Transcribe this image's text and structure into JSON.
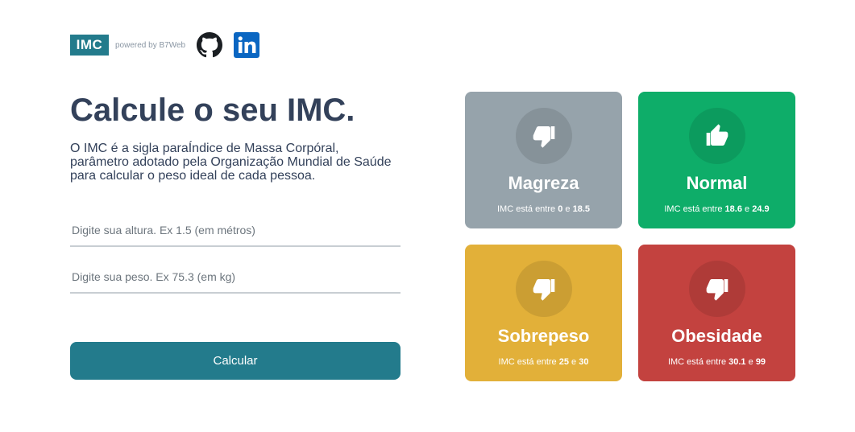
{
  "header": {
    "logo_text": "IMC",
    "powered_text": "powered by B7Web",
    "github_icon": "github-icon",
    "linkedin_icon": "linkedin-icon",
    "linkedin_color": "#0a66c2"
  },
  "main": {
    "title": "Calcule o seu IMC.",
    "description": "O IMC é a sigla paraÍndice de Massa Corpóral, parâmetro adotado pela Organização Mundial de Saúde para calcular o peso ideal de cada pessoa.",
    "height_placeholder": "Digite sua altura. Ex 1.5 (em métros)",
    "height_value": "",
    "weight_placeholder": "Digite sua peso. Ex 75.3 (em kg)",
    "weight_value": "",
    "button_label": "Calcular",
    "accent_color": "#237b8c"
  },
  "cards": [
    {
      "title": "Magreza",
      "range_prefix": "IMC está entre",
      "min": "0",
      "sep": "e",
      "max": "18.5",
      "icon": "thumbs-down-icon",
      "color": "#96a3ab"
    },
    {
      "title": "Normal",
      "range_prefix": "IMC está entre",
      "min": "18.6",
      "sep": "e",
      "max": "24.9",
      "icon": "thumbs-up-icon",
      "color": "#0ead69"
    },
    {
      "title": "Sobrepeso",
      "range_prefix": "IMC está entre",
      "min": "25",
      "sep": "e",
      "max": "30",
      "icon": "thumbs-down-icon",
      "color": "#e2b039"
    },
    {
      "title": "Obesidade",
      "range_prefix": "IMC está entre",
      "min": "30.1",
      "sep": "e",
      "max": "99",
      "icon": "thumbs-down-icon",
      "color": "#c3423f"
    }
  ]
}
